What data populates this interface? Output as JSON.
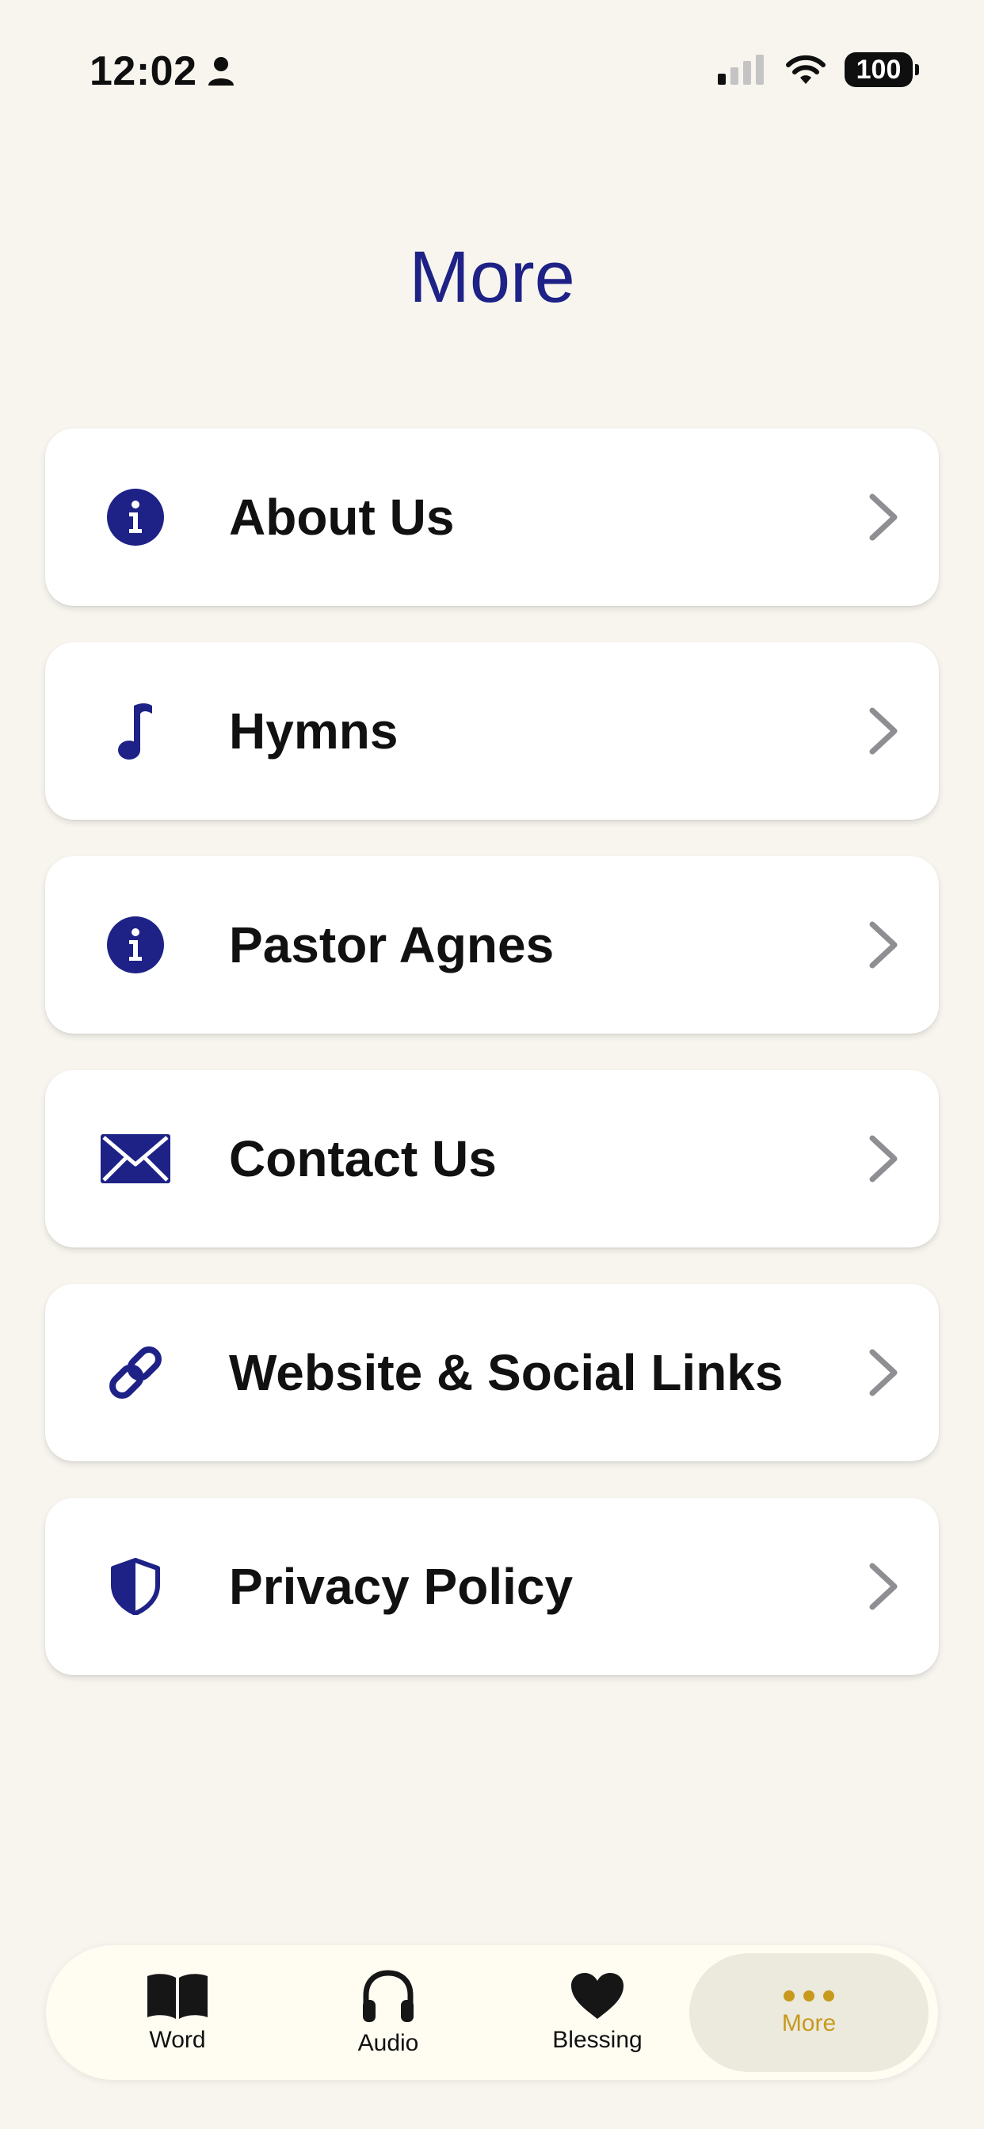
{
  "status_bar": {
    "time": "12:02",
    "battery": "100"
  },
  "page": {
    "title": "More"
  },
  "menu": {
    "items": [
      {
        "label": "About Us",
        "icon": "info-circle-icon"
      },
      {
        "label": "Hymns",
        "icon": "music-note-icon"
      },
      {
        "label": "Pastor Agnes",
        "icon": "info-circle-icon"
      },
      {
        "label": "Contact Us",
        "icon": "envelope-icon"
      },
      {
        "label": "Website & Social Links",
        "icon": "link-icon"
      },
      {
        "label": "Privacy Policy",
        "icon": "shield-icon"
      }
    ]
  },
  "tabs": [
    {
      "label": "Word",
      "icon": "book-icon",
      "active": false
    },
    {
      "label": "Audio",
      "icon": "headphones-icon",
      "active": false
    },
    {
      "label": "Blessing",
      "icon": "heart-icon",
      "active": false
    },
    {
      "label": "More",
      "icon": "ellipsis-icon",
      "active": true
    }
  ],
  "colors": {
    "background": "#f7f5ee",
    "accent_navy": "#1e2287",
    "accent_gold": "#c79a1d",
    "chevron_gray": "#8e8e93"
  }
}
